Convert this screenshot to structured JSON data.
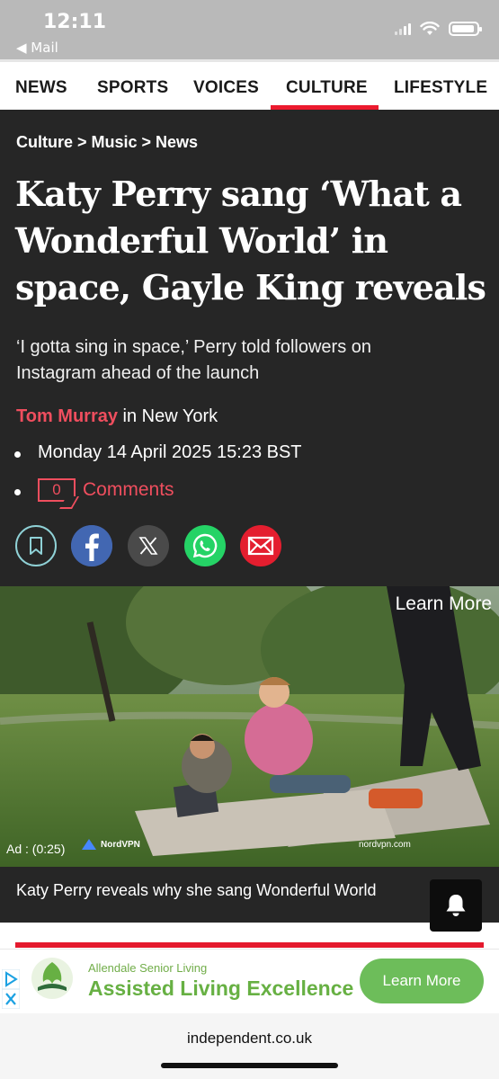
{
  "status_bar": {
    "time": "12:11",
    "back_label": "◀ Mail"
  },
  "nav": {
    "items": [
      "NEWS",
      "SPORTS",
      "VOICES",
      "CULTURE",
      "LIFESTYLE"
    ],
    "active": "CULTURE",
    "accent_color": "#ec1a2e"
  },
  "article": {
    "breadcrumb": "Culture > Music > News",
    "headline": "Katy Perry sang ‘What a Wonderful World’ in space, Gayle King reveals",
    "standfirst": "‘I gotta sing in space,’ Perry told followers on Instagram ahead of the launch",
    "author": "Tom Murray",
    "location": " in New York",
    "date": "Monday 14 April 2025 15:23 BST",
    "comment_count": "0",
    "comments_label": "Comments",
    "share_icons": [
      "bookmark-icon",
      "facebook-icon",
      "x-icon",
      "whatsapp-icon",
      "email-icon"
    ]
  },
  "video": {
    "learn_more": "Learn More",
    "ad_timer": "Ad : (0:25)",
    "brand": "NordVPN",
    "domain": "nordvpn.com",
    "caption": "Katy Perry reveals why she sang Wonderful World"
  },
  "ad_banner": {
    "advertiser": "Allendale Senior Living",
    "title": "Assisted Living Excellence",
    "button": "Learn More",
    "color": "#67b043"
  },
  "browser": {
    "url": "independent.co.uk"
  }
}
